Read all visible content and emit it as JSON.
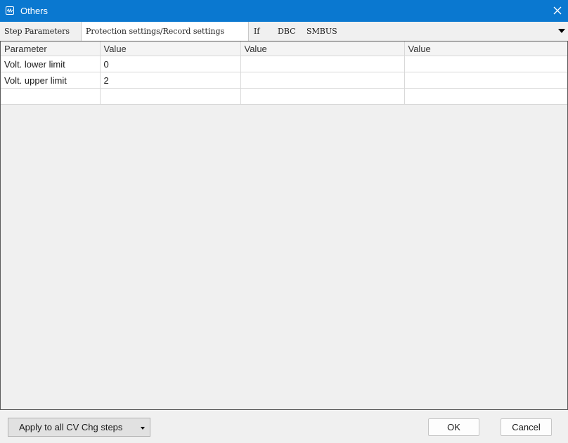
{
  "window": {
    "title": "Others"
  },
  "tabs": [
    {
      "label": "Step Parameters"
    },
    {
      "label": "Protection settings/Record settings"
    },
    {
      "label": "If"
    },
    {
      "label": "DBC"
    },
    {
      "label": "SMBUS"
    }
  ],
  "table": {
    "headers": [
      "Parameter",
      "Value",
      "Value",
      "Value"
    ],
    "rows": [
      [
        "Volt. lower limit",
        "0",
        "",
        ""
      ],
      [
        "Volt. upper limit",
        "2",
        "",
        ""
      ],
      [
        "",
        "",
        "",
        ""
      ]
    ]
  },
  "footer": {
    "apply_label": "Apply to all CV Chg steps",
    "ok_label": "OK",
    "cancel_label": "Cancel"
  },
  "colors": {
    "titlebar": "#0a78d0",
    "window_bg": "#f0f0f0"
  },
  "icons": {
    "app": "waveform-app-icon",
    "close": "close-icon",
    "tab_menu": "chevron-down-icon",
    "apply_dropdown": "dropdown-arrow-icon"
  }
}
